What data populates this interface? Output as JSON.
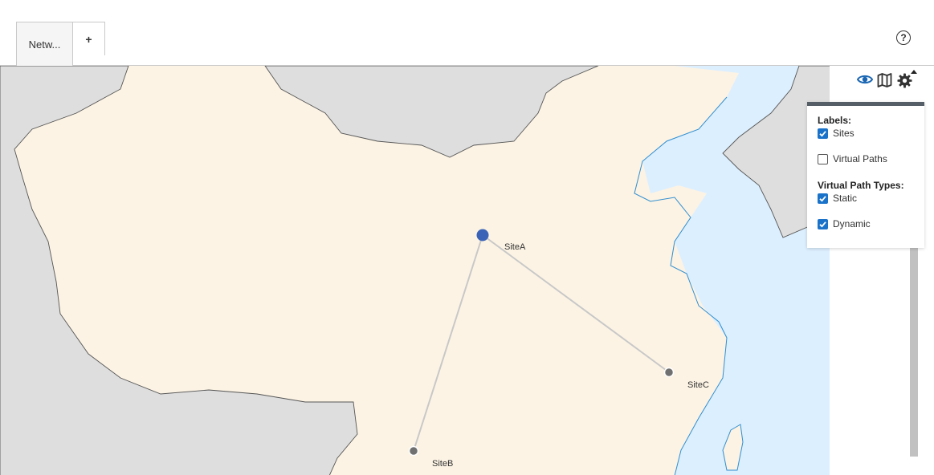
{
  "tabs": {
    "active_label": "Netw...",
    "add_label": "+"
  },
  "help": {
    "label": "?",
    "icon": "help-circle-icon"
  },
  "map": {
    "sites": [
      {
        "name": "SiteA",
        "role": "hub"
      },
      {
        "name": "SiteB",
        "role": "branch"
      },
      {
        "name": "SiteC",
        "role": "branch"
      }
    ],
    "paths": [
      {
        "from": "SiteA",
        "to": "SiteB"
      },
      {
        "from": "SiteA",
        "to": "SiteC"
      }
    ],
    "colors": {
      "land_focus": "#fcf3e4",
      "land_other": "#dedede",
      "water": "#dcefff",
      "border": "#555555",
      "coast": "#2f8ed0",
      "hub_site": "#3a63b8",
      "branch_site": "#707070",
      "path": "#c8c8c8"
    }
  },
  "toolbar": {
    "icons": [
      "eye-icon",
      "map-icon",
      "gear-icon"
    ],
    "accent": "#1a66b3"
  },
  "legend": {
    "labels_heading": "Labels:",
    "sites_label": "Sites",
    "sites_checked": true,
    "virtual_paths_label": "Virtual Paths",
    "virtual_paths_checked": false,
    "types_heading": "Virtual Path Types:",
    "static_label": "Static",
    "static_checked": true,
    "dynamic_label": "Dynamic",
    "dynamic_checked": true
  }
}
